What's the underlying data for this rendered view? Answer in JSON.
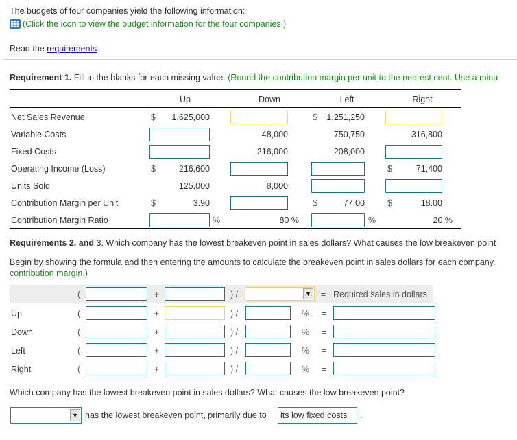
{
  "intro": {
    "text": "The budgets of four companies yield the following information:",
    "icon": "table-grid-icon",
    "click_text": "(Click the icon to view the budget information for the four companies.)",
    "read_prefix": "Read the ",
    "requirements_link": "requirements",
    "read_suffix": "."
  },
  "req1": {
    "label": "Requirement 1.",
    "text": " Fill in the blanks for each missing value. ",
    "hint": "(Round the contribution margin per unit to the nearest cent. Use a minu",
    "columns": [
      "Up",
      "Down",
      "Left",
      "Right"
    ],
    "rows": [
      {
        "label": "Net Sales Revenue",
        "up": "1,625,000",
        "up_dollar": "$",
        "down": "",
        "left": "1,251,250",
        "left_dollar": "$",
        "right": ""
      },
      {
        "label": "Variable Costs",
        "up": "",
        "down": "48,000",
        "left": "750,750",
        "right": "316,800"
      },
      {
        "label": "Fixed Costs",
        "up": "",
        "down": "216,000",
        "left": "208,000",
        "right": ""
      },
      {
        "label": "Operating Income (Loss)",
        "up": "216,600",
        "up_dollar": "$",
        "down": "",
        "left": "",
        "right": "71,400",
        "right_dollar": "$"
      },
      {
        "label": "Units Sold",
        "up": "125,000",
        "down": "8,000",
        "left": "",
        "right": ""
      },
      {
        "label": "Contribution Margin per Unit",
        "up": "3.90",
        "up_dollar": "$",
        "down": "",
        "left": "77.00",
        "left_dollar": "$",
        "right": "18.00",
        "right_dollar": "$"
      },
      {
        "label": "Contribution Margin Ratio",
        "up": "",
        "down": "80 %",
        "left": "",
        "right": "20 %",
        "pct": "%"
      }
    ]
  },
  "req23": {
    "label_a": "Requirements 2.",
    "label_and": " and ",
    "label_b": "3.",
    "question": " Which company has the lowest breakeven point in sales dollars? What causes the low breakeven point",
    "instruction": "Begin by showing the formula and then entering the amounts to calculate the breakeven point in sales dollars for each company.",
    "instruction_hint": "contribution margin.)",
    "formula": {
      "open_paren": "(",
      "plus": "+",
      "close_div": ") /",
      "equals": "=",
      "pct": "%",
      "result_label": "Required sales in dollars",
      "dropdown_value": ""
    },
    "companies": [
      "Up",
      "Down",
      "Left",
      "Right"
    ],
    "final_question": "Which company has the lowest breakeven point in sales dollars? What causes the low breakeven point?",
    "answer_dropdown_value": "",
    "answer_mid_text": "has the lowest breakeven point, primarily due to",
    "answer_reason": "its low fixed costs",
    "answer_end": "."
  },
  "colors": {
    "hint_green": "#1b8a1b",
    "input_border": "#1d7487",
    "input_highlight": "#f3d95a",
    "link_blue": "#1a0dab"
  }
}
